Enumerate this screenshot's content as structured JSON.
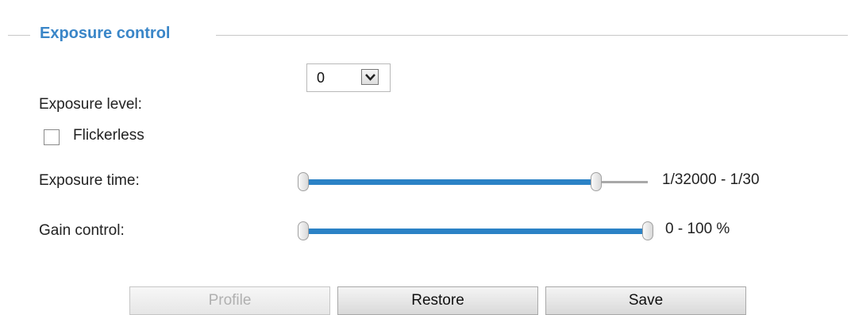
{
  "section": {
    "title": "Exposure control"
  },
  "exposure_level": {
    "label": "Exposure level:",
    "selected_value": "0",
    "arrow_icon": "chevron-down-icon"
  },
  "flickerless": {
    "label": "Flickerless",
    "checked": false
  },
  "exposure_time": {
    "label": "Exposure time:",
    "range_text": "1/32000 - 1/30",
    "fill_fraction": 0.85
  },
  "gain_control": {
    "label": "Gain control:",
    "range_text": "0 - 100 %",
    "fill_fraction": 1.0
  },
  "buttons": {
    "profile_label": "Profile",
    "restore_label": "Restore",
    "save_label": "Save"
  },
  "colors": {
    "accent": "#3a86c8",
    "slider_fill": "#2b82c6"
  }
}
